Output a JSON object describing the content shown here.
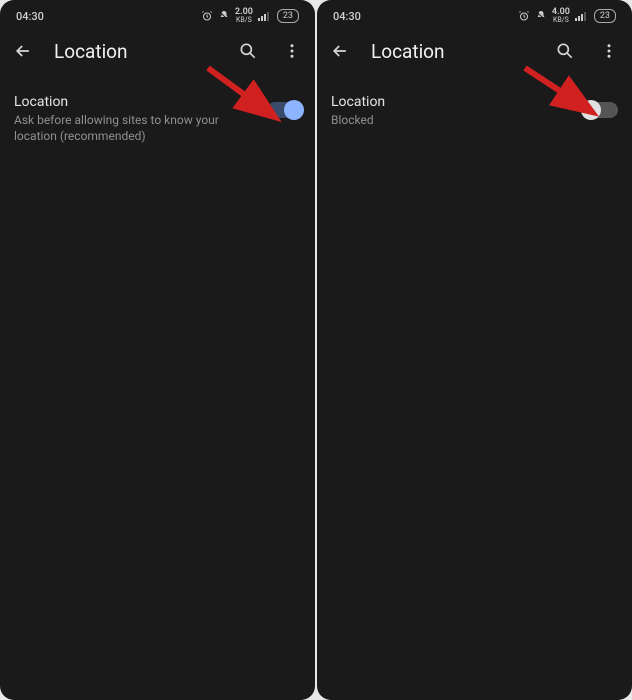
{
  "colors": {
    "arrow": "#d02020",
    "toggle_on_thumb": "#8db4ff",
    "toggle_on_track": "#3a4a6a"
  },
  "status": {
    "time": "04:30",
    "speed_value": "2.00",
    "speed_value_alt": "4.00",
    "speed_unit": "KB/S",
    "battery": "23"
  },
  "appbar": {
    "title": "Location"
  },
  "panels": [
    {
      "setting_title": "Location",
      "setting_sub": "Ask before allowing sites to know your location (recommended)",
      "toggle_on": true
    },
    {
      "setting_title": "Location",
      "setting_sub": "Blocked",
      "toggle_on": false
    }
  ]
}
